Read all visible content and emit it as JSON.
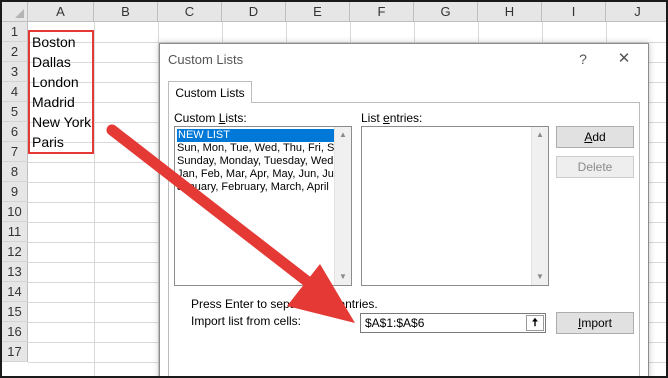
{
  "sheet": {
    "columns": [
      "A",
      "B",
      "C",
      "D",
      "E",
      "F",
      "G",
      "H",
      "I",
      "J"
    ],
    "rows": [
      "1",
      "2",
      "3",
      "4",
      "5",
      "6",
      "7",
      "8",
      "9",
      "10",
      "11",
      "12",
      "13",
      "14",
      "15",
      "16",
      "17"
    ],
    "cells": [
      "Boston",
      "Dallas",
      "London",
      "Madrid",
      "New York",
      "Paris"
    ]
  },
  "dialog": {
    "title": "Custom Lists",
    "help": "?",
    "close": "✕",
    "tab": "Custom Lists",
    "custom_lists_label_accel": "L",
    "custom_lists_label_pre": "Custom ",
    "custom_lists_label_post": "ists:",
    "custom_lists": [
      "NEW LIST",
      "Sun, Mon, Tue, Wed, Thu, Fri, Sat",
      "Sunday, Monday, Tuesday, Wednesday",
      "Jan, Feb, Mar, Apr, May, Jun, Jul",
      "January, February, March, April"
    ],
    "list_entries_label_pre": "List ",
    "list_entries_label_accel": "e",
    "list_entries_label_post": "ntries:",
    "add_button_accel": "A",
    "add_button_post": "dd",
    "delete_button": "Delete",
    "hint": "Press Enter to separate list entries.",
    "import_label": "Import list from cells:",
    "import_range": "$A$1:$A$6",
    "collapse_glyph": "🠅",
    "import_button_accel": "I",
    "import_button_post": "mport"
  },
  "colors": {
    "highlight": "#e53935",
    "selection": "#0078d7",
    "arrow": "#e53935"
  }
}
